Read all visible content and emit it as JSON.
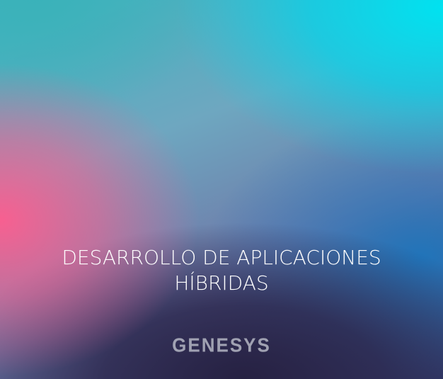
{
  "banner": {
    "title_line1": "DESARROLLO DE APLICACIONES",
    "title_line2": "HÍBRIDAS",
    "logo_text": "GENESYS"
  },
  "colors": {
    "top_right": "#00e2f0",
    "left_middle": "#ff5c8e",
    "bottom": "#262142",
    "title": "#ffffff",
    "logo": "#b5b7c4"
  }
}
